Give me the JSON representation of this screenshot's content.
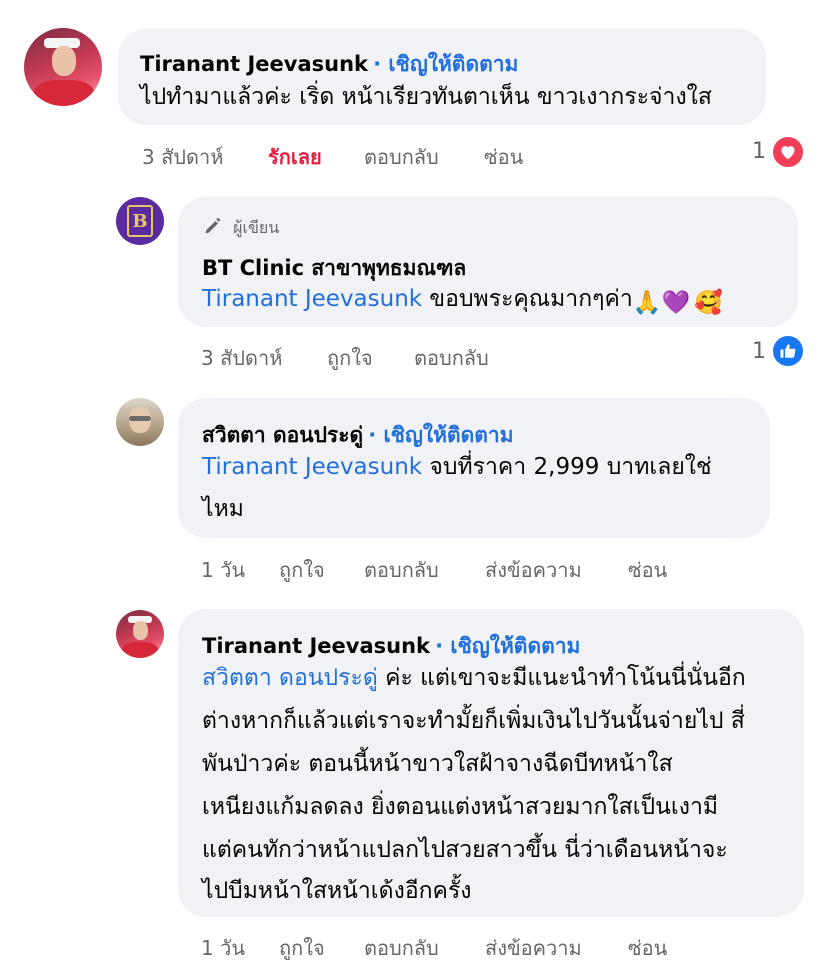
{
  "comments": [
    {
      "author": "Tiranant Jeevasunk",
      "follow": "· เชิญให้ติดตาม",
      "text": "ไปทำมาแล้วค่ะ เริ่ด หน้าเรียวทันตาเห็น ขาวเงากระจ่างใส",
      "time": "3 สัปดาห์",
      "like": "รักเลย",
      "reply": "ตอบกลับ",
      "hide": "ซ่อน",
      "reaction_count": "1",
      "reaction_icon": "heart-icon",
      "reaction_color": "#f33e58"
    },
    {
      "author_badge": "ผู้เขียน",
      "author": "BT Clinic สาขาพุทธมณฑล",
      "mention": "Tiranant Jeevasunk",
      "text": " ขอบพระคุณมากๆค่า",
      "emojis": [
        "🙏",
        "💜",
        "🥰"
      ],
      "avatar_letter": "B",
      "time": "3 สัปดาห์",
      "like": "ถูกใจ",
      "reply": "ตอบกลับ",
      "reaction_count": "1",
      "reaction_icon": "thumbs-up-icon",
      "reaction_color": "#1877f2"
    },
    {
      "author": "สวิตตา ดอนประดู่",
      "follow": "· เชิญให้ติดตาม",
      "mention": "Tiranant Jeevasunk",
      "text_line1": " จบที่ราคา 2,999 บาทเลยใช่",
      "text_line2": "ไหม",
      "time": "1 วัน",
      "like": "ถูกใจ",
      "reply": "ตอบกลับ",
      "message": "ส่งข้อความ",
      "hide": "ซ่อน"
    },
    {
      "author": "Tiranant Jeevasunk",
      "follow": "· เชิญให้ติดตาม",
      "mention": "สวิตตา ดอนประดู่",
      "line1": " ค่ะ แต่เขาจะมีแนะนำทำโน้นนี่นั่นอีก",
      "line2": "ต่างหากก็แล้วแต่เราจะทำมั้ยก็เพิ่มเงินไปวันนั้นจ่ายไป สี่",
      "line3": "พันป่าวค่ะ ตอนนี้หน้าขาวใสฝ้าจางฉีดบีทหน้าใส",
      "line4": "เหนียงแก้มลดลง ยิ่งตอนแต่งหน้าสวยมากใสเป็นเงามี",
      "line5": "แต่คนทักว่าหน้าแปลกไปสวยสาวขึ้น นี่ว่าเดือนหน้าจะ",
      "line6": "ไปบีมหน้าใสหน้าเด้งอีกครั้ง",
      "time": "1 วัน",
      "like": "ถูกใจ",
      "reply": "ตอบกลับ",
      "message": "ส่งข้อความ",
      "hide": "ซ่อน"
    }
  ]
}
